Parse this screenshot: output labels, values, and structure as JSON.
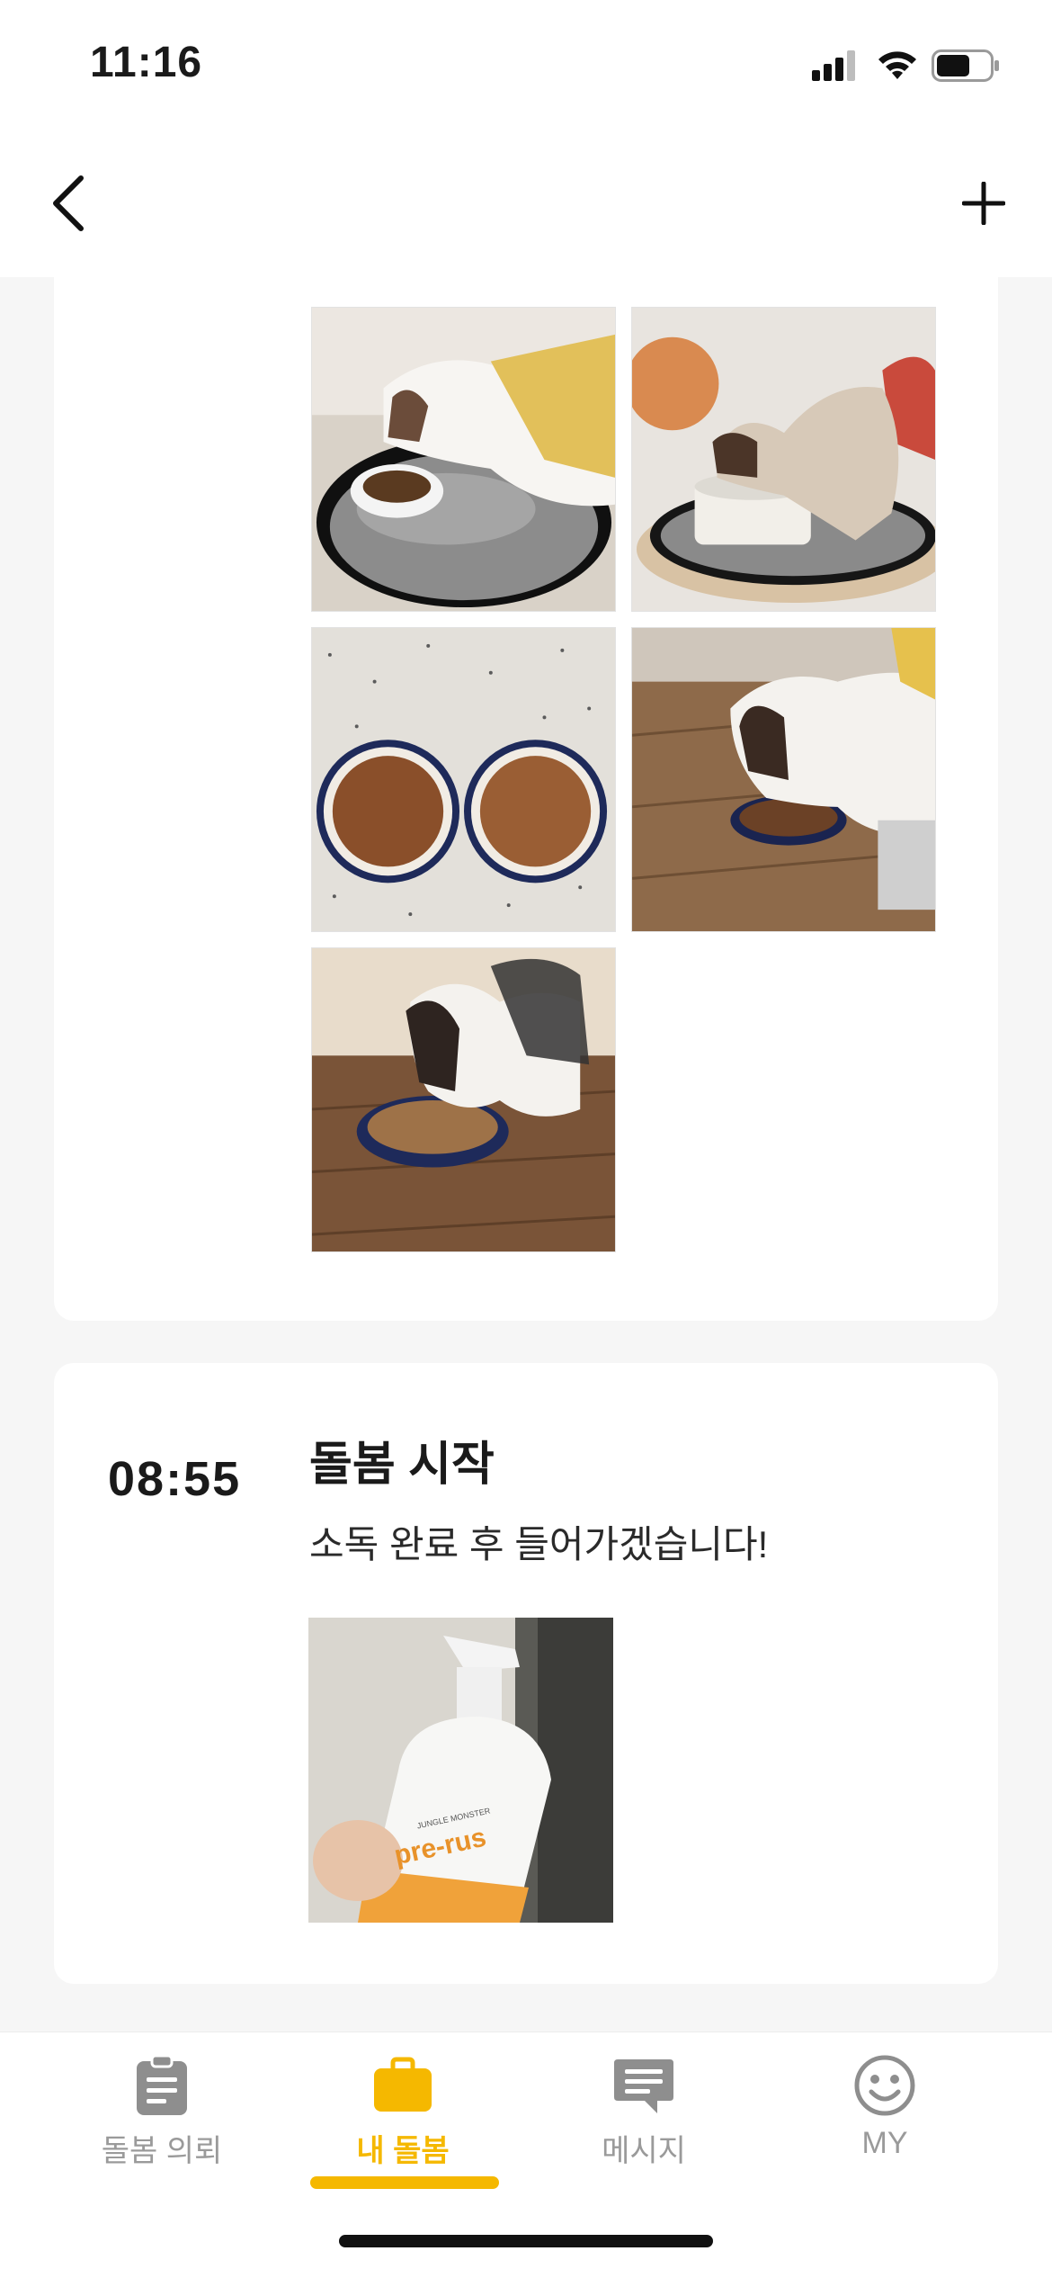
{
  "status_bar": {
    "time": "11:16"
  },
  "nav": {
    "back_icon": "chevron-left-icon",
    "add_icon": "plus-icon"
  },
  "feed": {
    "first_card": {
      "photos": [
        "cat-eating-photo-1",
        "cat-eating-photo-2",
        "food-bowls-photo",
        "cat-eating-photo-3",
        "cat-eating-photo-4"
      ]
    },
    "second_card": {
      "time": "08:55",
      "title": "돌봄 시작",
      "message": "소독 완료 후 들어가겠습니다!",
      "photos": [
        "disinfectant-spray-photo"
      ],
      "product_label": "pre-rus",
      "product_brand": "JUNGLE MONSTER"
    }
  },
  "tab_bar": {
    "tabs": [
      {
        "label": "돌봄 의뢰",
        "icon": "clipboard-icon",
        "active": false
      },
      {
        "label": "내 돌봄",
        "icon": "briefcase-icon",
        "active": true
      },
      {
        "label": "메시지",
        "icon": "message-icon",
        "active": false
      },
      {
        "label": "MY",
        "icon": "smiley-icon",
        "active": false
      }
    ]
  },
  "colors": {
    "accent": "#f5b800",
    "inactive": "#9a9a9a",
    "background": "#f6f6f6"
  }
}
